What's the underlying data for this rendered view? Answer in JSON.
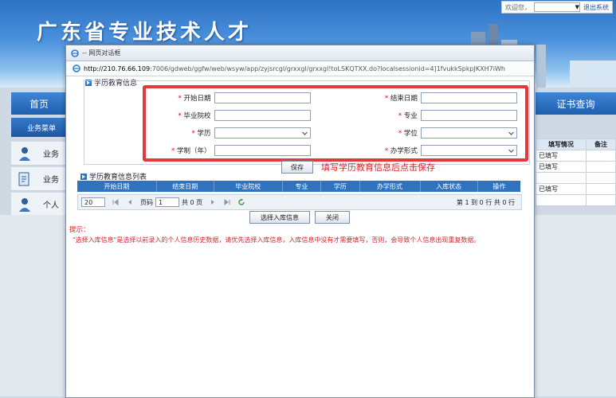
{
  "portal": {
    "title": "广东省专业技术人才",
    "topbar": {
      "welcome": "欢迎您，",
      "user_select": "▼",
      "logout": "退出系统"
    },
    "nav_home": "首页",
    "nav_cert": "证书查询",
    "side_menu_title": "业务菜单",
    "side_items": [
      "业务",
      "业务",
      "个人"
    ],
    "right_table": {
      "headers": [
        "填写情况",
        "备注"
      ],
      "rows": [
        "已填写",
        "已填写",
        "",
        "已填写",
        ""
      ]
    }
  },
  "dialog": {
    "title": "-- 网页对话框",
    "url_host": "http://210.76.66.109",
    "url_rest": ":7006/gdweb/ggfw/web/wsyw/app/zyjsrcgl/grxxgl/grxxgl!toLSKQTXX.do?localsessionid=4]1fvukkSpkpJKXH7iWh",
    "section_title": "学历教育信息",
    "fields": {
      "start_date": "开始日期",
      "end_date": "结束日期",
      "school": "毕业院校",
      "major": "专业",
      "education": "学历",
      "degree": "学位",
      "duration": "学制（年）",
      "study_mode": "办学形式"
    },
    "required_mark": "*",
    "save_label": "保存",
    "save_hint": "填写学历教育信息后点击保存",
    "list_title": "学历教育信息列表",
    "list_columns": [
      "开始日期",
      "结束日期",
      "毕业院校",
      "专业",
      "学历",
      "办学形式",
      "入库状态",
      "操作"
    ],
    "pager": {
      "page_size": "20",
      "page_label": "页码",
      "page_value": "1",
      "total_pages": "共 0 页",
      "count": "第 1 到 0 行 共 0 行"
    },
    "select_button": "选择入库信息",
    "close_button": "关闭",
    "tip_title": "提示：",
    "tip_text": "\"选择入库信息\"是选择以前录入的个人信息历史数据，请优先选择入库信息，入库信息中没有才需要填写，否则，会导致个人信息出现重复数据。"
  },
  "colors": {
    "header_blue": "#2f73bf",
    "alert_red": "#d7262a",
    "highlight_red": "#e23a3a"
  }
}
